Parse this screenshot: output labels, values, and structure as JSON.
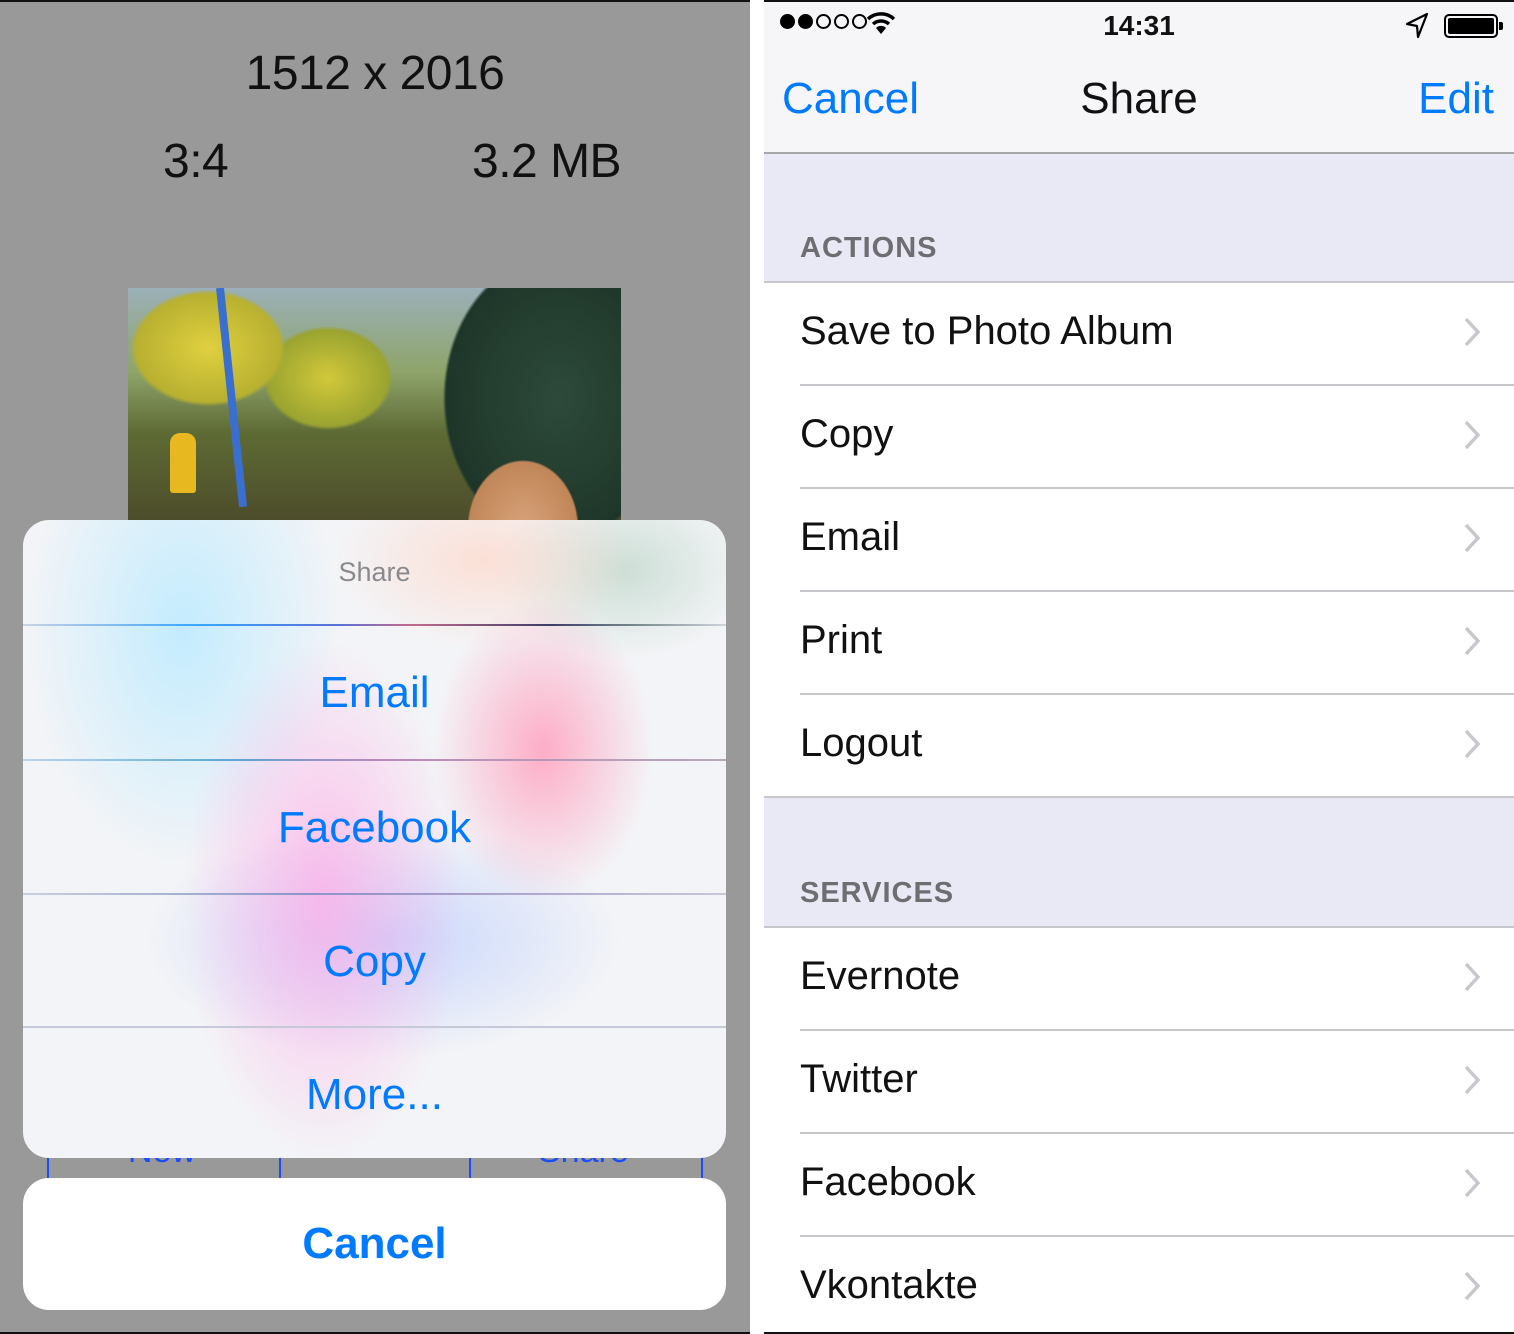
{
  "left_screen": {
    "image_dimensions": "1512 x 2016",
    "aspect_ratio": "3:4",
    "file_size": "3.2 MB",
    "background_buttons": [
      "New",
      "Share"
    ],
    "action_sheet": {
      "title": "Share",
      "items": [
        "Email",
        "Facebook",
        "Copy",
        "More..."
      ],
      "cancel_label": "Cancel"
    }
  },
  "right_screen": {
    "status_bar": {
      "signal_bars_filled": 2,
      "signal_bars_total": 5,
      "time": "14:31",
      "icons": [
        "wifi-icon",
        "location-arrow-icon",
        "battery-icon"
      ]
    },
    "nav_bar": {
      "left_button": "Cancel",
      "title": "Share",
      "right_button": "Edit"
    },
    "sections": [
      {
        "header": "ACTIONS",
        "rows": [
          "Save to Photo Album",
          "Copy",
          "Email",
          "Print",
          "Logout"
        ]
      },
      {
        "header": "SERVICES",
        "rows": [
          "Evernote",
          "Twitter",
          "Facebook",
          "Vkontakte"
        ]
      }
    ]
  },
  "colors": {
    "accent": "#007aff",
    "dim_overlay": "#999999",
    "section_background": "#e9e8f5",
    "section_header_text": "#6d6d72",
    "separator": "#c8c7cc",
    "chevron": "#c7c7cc"
  }
}
